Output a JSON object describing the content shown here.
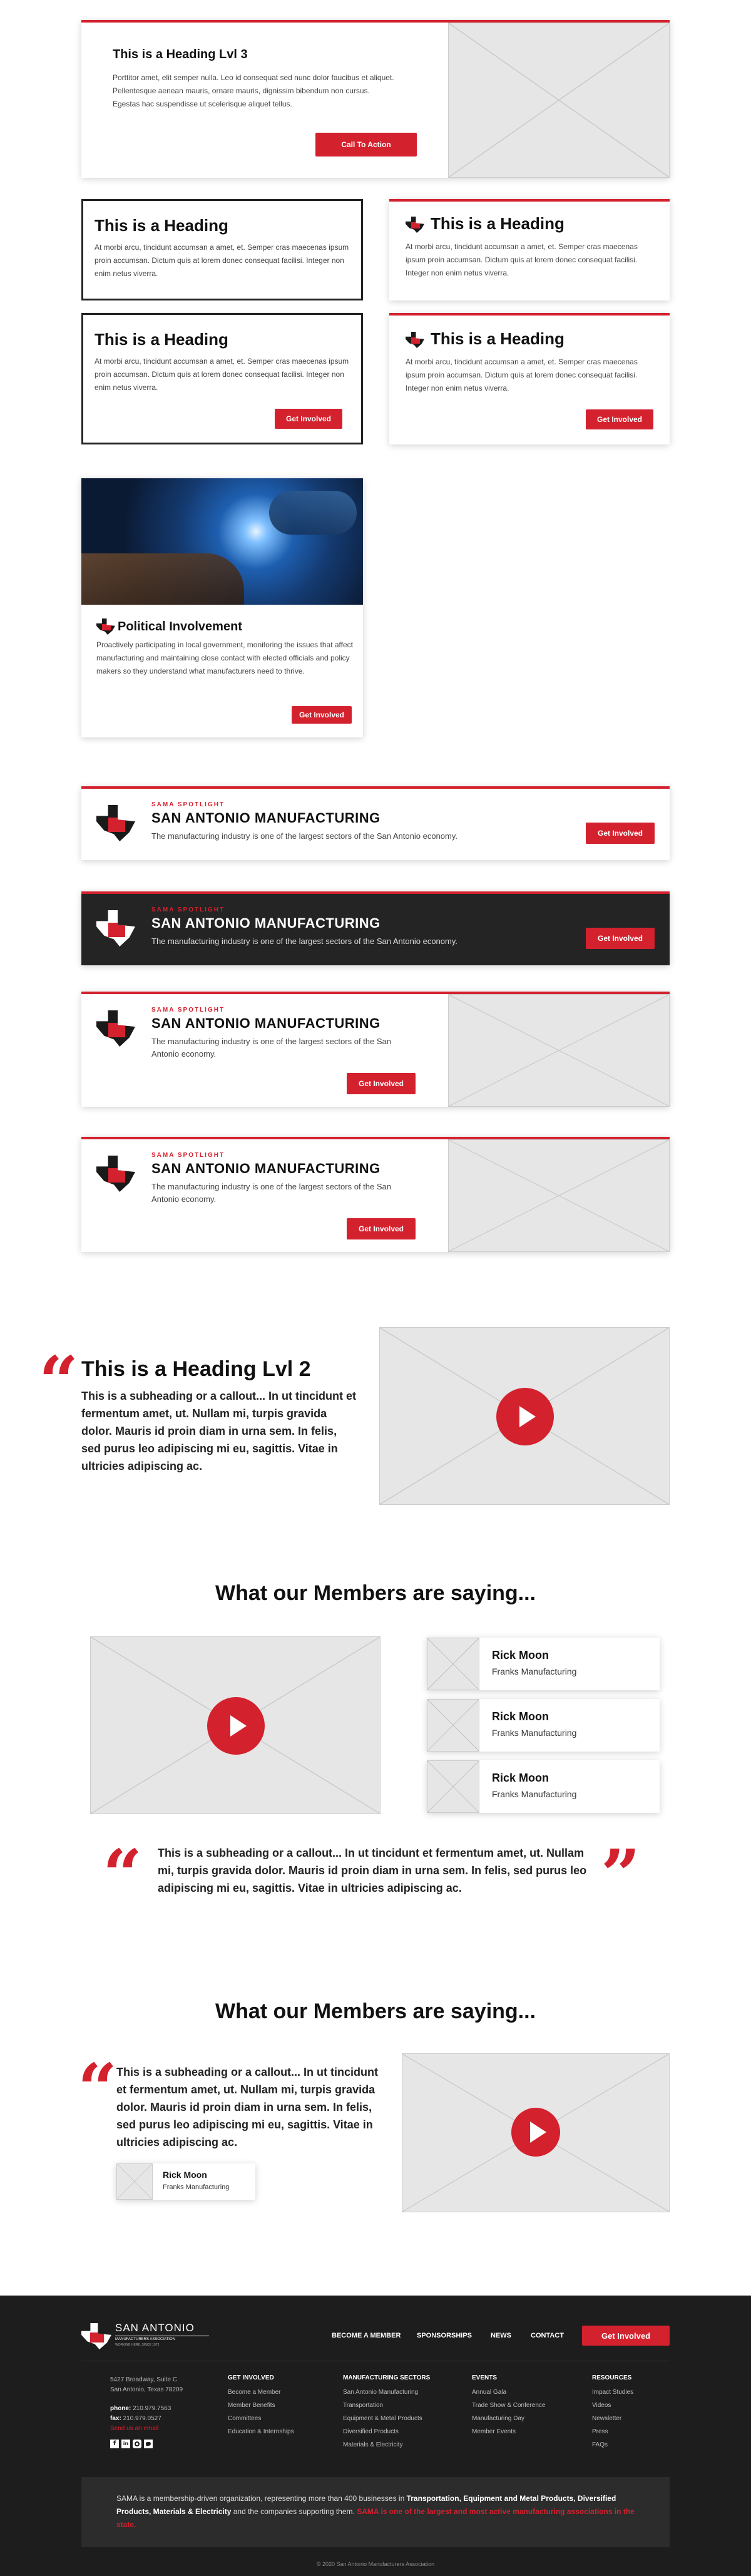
{
  "card_lvl3": {
    "heading": "This is a Heading Lvl 3",
    "body": "Porttitor amet, elit semper nulla. Leo id consequat sed nunc dolor faucibus et aliquet. Pellentesque aenean mauris, ornare mauris, dignissim bibendum non cursus. Egestas hac suspendisse ut scelerisque aliquet tellus.",
    "cta": "Call To Action"
  },
  "grid_cards": [
    {
      "heading": "This is a Heading",
      "body": "At morbi arcu, tincidunt accumsan a amet, et. Semper cras maecenas ipsum proin accumsan. Dictum quis at lorem donec consequat facilisi. Integer non enim netus viverra."
    },
    {
      "heading": "This is a Heading",
      "body": "At morbi arcu, tincidunt accumsan a amet, et. Semper cras maecenas ipsum proin accumsan. Dictum quis at lorem donec consequat facilisi. Integer non enim netus viverra."
    },
    {
      "heading": "This is a Heading",
      "body": "At morbi arcu, tincidunt accumsan a amet, et. Semper cras maecenas ipsum proin accumsan. Dictum quis at lorem donec consequat facilisi. Integer non enim netus viverra.",
      "button": "Get Involved"
    },
    {
      "heading": "This is a Heading",
      "body": "At morbi arcu, tincidunt accumsan a amet, et. Semper cras maecenas ipsum proin accumsan. Dictum quis at lorem donec consequat facilisi. Integer non enim netus viverra.",
      "button": "Get Involved"
    }
  ],
  "political": {
    "heading": "Political Involvement",
    "body": "Proactively participating in local government, monitoring the issues that affect manufacturing and maintaining close contact with elected officials and policy makers so they understand what manufacturers need to thrive.",
    "button": "Get Involved"
  },
  "spotlight": {
    "kicker": "SAMA SPOTLIGHT",
    "title": "SAN ANTONIO MANUFACTURING",
    "desc": "The manufacturing industry is one of the largest sectors of the San Antonio economy.",
    "button": "Get Involved"
  },
  "callout_lvl2": {
    "quote_mark": "“",
    "heading": "This is a Heading Lvl 2",
    "body": "This is a subheading or a callout... In ut tincidunt et fermentum amet, ut. Nullam mi, turpis gravida dolor. Mauris id proin diam in urna sem. In felis, sed purus leo adipiscing mi eu, sagittis. Vitae in ultricies adipiscing ac."
  },
  "members1": {
    "heading": "What our Members are saying...",
    "testimonials": [
      {
        "name": "Rick Moon",
        "company": "Franks Manufacturing"
      },
      {
        "name": "Rick Moon",
        "company": "Franks Manufacturing"
      },
      {
        "name": "Rick Moon",
        "company": "Franks Manufacturing"
      }
    ],
    "quote": "This is a subheading or a callout... In ut tincidunt et fermentum amet, ut. Nullam mi, turpis gravida dolor. Mauris id proin diam in urna sem. In felis, sed purus leo adipiscing mi eu, sagittis. Vitae in ultricies adipiscing ac.",
    "open_mark": "“",
    "close_mark": "”"
  },
  "members2": {
    "heading": "What our Members are saying...",
    "quote": "This is a subheading or a callout... In ut tincidunt et fermentum amet, ut. Nullam mi, turpis gravida dolor. Mauris id proin diam in urna sem. In felis, sed purus leo adipiscing mi eu, sagittis. Vitae in ultricies adipiscing ac.",
    "name": "Rick Moon",
    "company": "Franks Manufacturing"
  },
  "footer": {
    "logo_top": "SAN ANTONIO",
    "logo_sub": "MANUFACTURERS ASSOCIATION",
    "logo_tag": "WORKING HERE, SINCE 1973",
    "nav": [
      "BECOME A MEMBER",
      "SPONSORSHIPS",
      "NEWS",
      "CONTACT"
    ],
    "nav_button": "Get Involved",
    "address1": "5427 Broadway, Suite C",
    "address2": "San Antonio, Texas 78209",
    "phone_label": "phone:",
    "phone": "210.979.7563",
    "fax_label": "fax:",
    "fax": "210.979.0527",
    "email": "Send us an email",
    "columns": [
      {
        "title": "GET INVOLVED",
        "items": [
          "Become a Member",
          "Member Benefits",
          "Committees",
          "Education & Internships"
        ]
      },
      {
        "title": "MANUFACTURING SECTORS",
        "items": [
          "San Antonio Manufacturing",
          "Transportation",
          "Equipment & Metal Products",
          "Diversified Products",
          "Materials & Electricity"
        ]
      },
      {
        "title": "EVENTS",
        "items": [
          "Annual Gala",
          "Trade Show & Conference",
          "Manufacturing Day",
          "Member Events"
        ]
      },
      {
        "title": "RESOURCES",
        "items": [
          "Impact Studies",
          "Videos",
          "Newsletter",
          "Press",
          "FAQs"
        ]
      }
    ],
    "about_pre": "SAMA is a membership-driven organization, representing more than 400 businesses in ",
    "about_bold1": "Transportation, Equipment and Metal Products, Diversified Products, Materials & Electricity",
    "about_mid": " and the companies supporting them. ",
    "about_red": "SAMA is one of the largest and most active manufacturing associations in the state.",
    "copyright": "© 2020 San Antonio Manufacturers Association",
    "colors": {
      "accent": "#d4212e",
      "dark": "#1d1d1d"
    }
  }
}
